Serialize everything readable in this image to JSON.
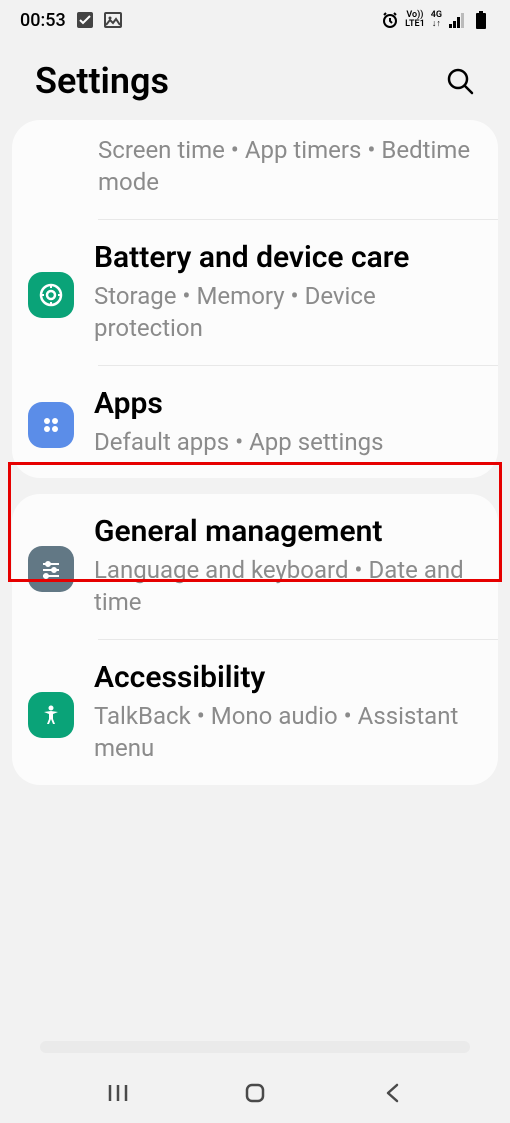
{
  "status": {
    "time": "00:53",
    "network_label_top": "Vo))",
    "network_label_bottom": "LTE1",
    "network_gen": "4G"
  },
  "header": {
    "title": "Settings"
  },
  "card1": {
    "partial": {
      "sub": "Screen time  •  App timers  •  Bedtime mode"
    },
    "battery": {
      "title": "Battery and device care",
      "sub": "Storage  •  Memory  •  Device protection"
    },
    "apps": {
      "title": "Apps",
      "sub": "Default apps  •  App settings"
    }
  },
  "card2": {
    "general": {
      "title": "General management",
      "sub": "Language and keyboard  •  Date and time"
    },
    "access": {
      "title": "Accessibility",
      "sub": "TalkBack  •  Mono audio  •  Assistant menu"
    }
  },
  "colors": {
    "battery_icon_bg": "#0aa378",
    "apps_icon_bg": "#5b8de8",
    "general_icon_bg": "#627885",
    "access_icon_bg": "#0aa378"
  }
}
